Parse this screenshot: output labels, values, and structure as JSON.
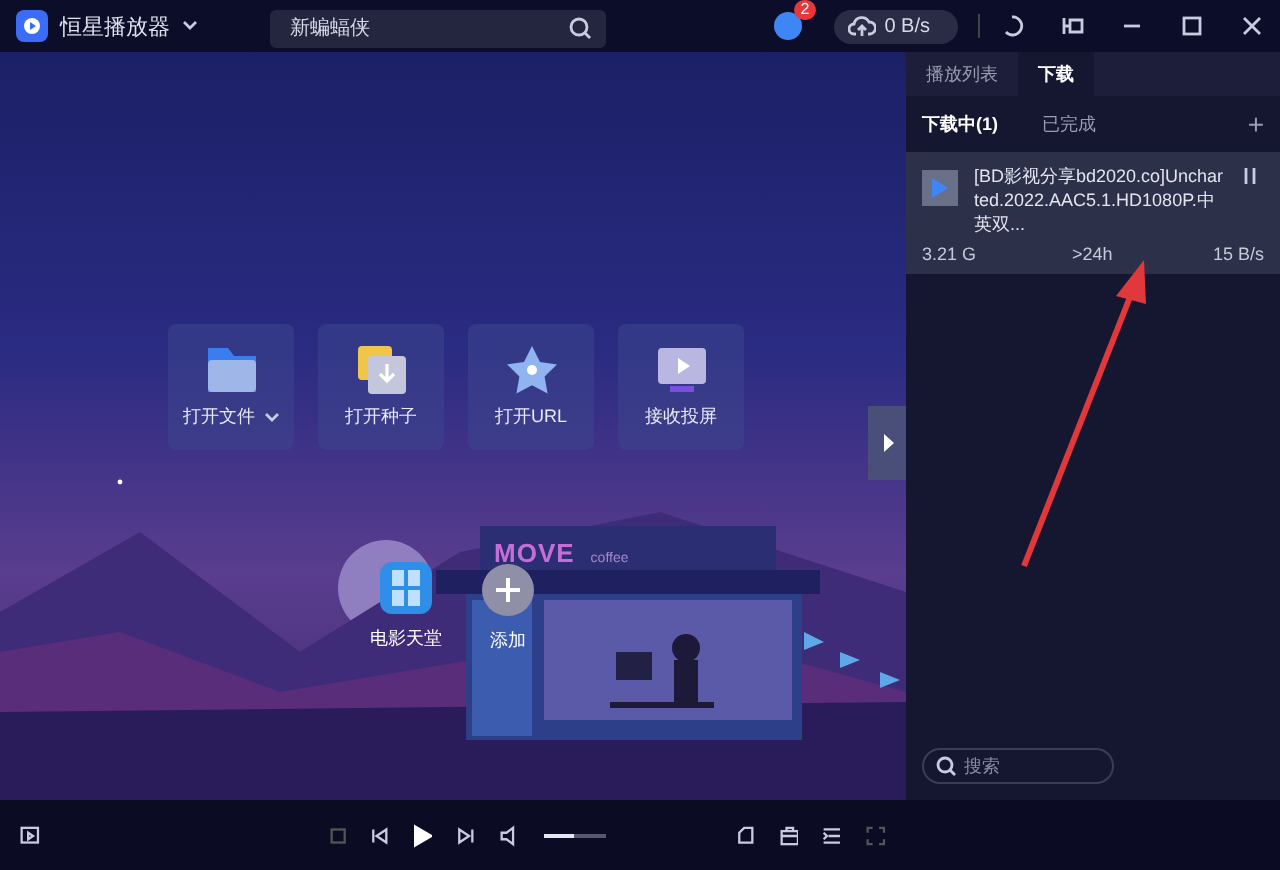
{
  "window": {
    "app_name": "恒星播放器",
    "search": {
      "placeholder": "新蝙蝠侠"
    },
    "notification_badge": "2",
    "speed": "0 B/s"
  },
  "quick_actions": [
    {
      "kind": "file",
      "label": "打开文件",
      "has_menu": true
    },
    {
      "kind": "torrent",
      "label": "打开种子",
      "has_menu": false
    },
    {
      "kind": "url",
      "label": "打开URL",
      "has_menu": false
    },
    {
      "kind": "cast",
      "label": "接收投屏",
      "has_menu": false
    }
  ],
  "scene": {
    "sign_title": "MOVE",
    "sign_subtitle": "coffee"
  },
  "shortcuts": [
    {
      "kind": "film",
      "label": "电影天堂"
    },
    {
      "kind": "add",
      "label": "添加"
    }
  ],
  "player_bar": {
    "volume": {
      "level": 0.5
    }
  },
  "side_panel": {
    "tabs": [
      {
        "label": "播放列表",
        "selected": false
      },
      {
        "label": "下载",
        "selected": true
      }
    ],
    "subtabs": [
      {
        "label": "下载中(1)",
        "selected": true
      },
      {
        "label": "已完成",
        "selected": false
      }
    ],
    "add_button": "+",
    "downloads": [
      {
        "title": "[BD影视分享bd2020.co]Uncharted.2022.AAC5.1.HD1080P.中英双...",
        "size": "3.21 G",
        "remaining": ">24h",
        "speed": "15 B/s"
      }
    ],
    "search": {
      "placeholder": "搜索"
    }
  }
}
